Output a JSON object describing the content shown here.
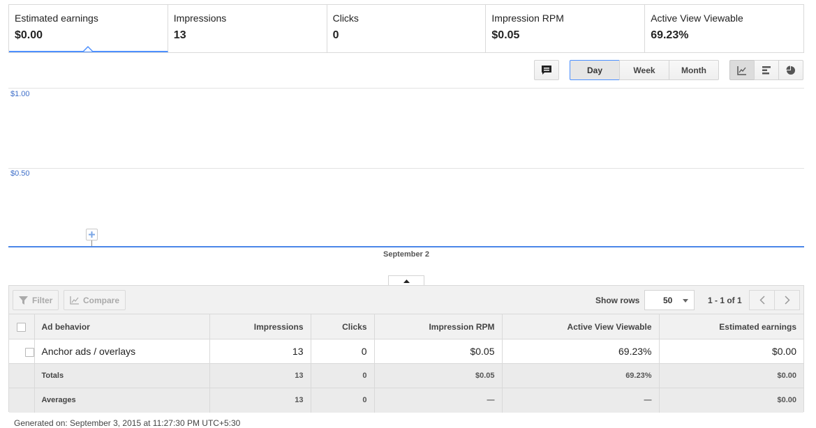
{
  "scorecards": [
    {
      "label": "Estimated earnings",
      "value": "$0.00",
      "active": true
    },
    {
      "label": "Impressions",
      "value": "13"
    },
    {
      "label": "Clicks",
      "value": "0"
    },
    {
      "label": "Impression RPM",
      "value": "$0.05"
    },
    {
      "label": "Active View Viewable",
      "value": "69.23%"
    }
  ],
  "toolbar": {
    "annotation_icon": "comment-icon",
    "granularity": [
      "Day",
      "Week",
      "Month"
    ],
    "selected_granularity": "Day",
    "chart_types": [
      "line-chart-icon",
      "bar-chart-icon",
      "pie-chart-icon"
    ],
    "selected_chart_type": "line-chart-icon"
  },
  "chart_data": {
    "type": "line",
    "x": [
      "September 2"
    ],
    "series": [
      {
        "values": [
          0.0
        ]
      }
    ],
    "y_ticks": [
      "$1.00",
      "$0.50"
    ],
    "ylim": [
      0,
      1.0
    ],
    "xlabel": "September 2",
    "grid": true,
    "color": "#4a86e8"
  },
  "table_bar": {
    "filter_label": "Filter",
    "compare_label": "Compare",
    "show_rows_label": "Show rows",
    "rows_value": "50",
    "page_info": "1 - 1 of 1"
  },
  "table": {
    "columns": [
      "Ad behavior",
      "Impressions",
      "Clicks",
      "Impression RPM",
      "Active View Viewable",
      "Estimated earnings"
    ],
    "rows": [
      {
        "name": "Anchor ads / overlays",
        "impressions": "13",
        "clicks": "0",
        "rpm": "$0.05",
        "viewable": "69.23%",
        "earnings": "$0.00"
      }
    ],
    "totals": {
      "label": "Totals",
      "impressions": "13",
      "clicks": "0",
      "rpm": "$0.05",
      "viewable": "69.23%",
      "earnings": "$0.00"
    },
    "averages": {
      "label": "Averages",
      "impressions": "13",
      "clicks": "0",
      "rpm": "—",
      "viewable": "—",
      "earnings": "$0.00"
    }
  },
  "footer": "Generated on: September 3, 2015 at 11:27:30 PM UTC+5:30"
}
